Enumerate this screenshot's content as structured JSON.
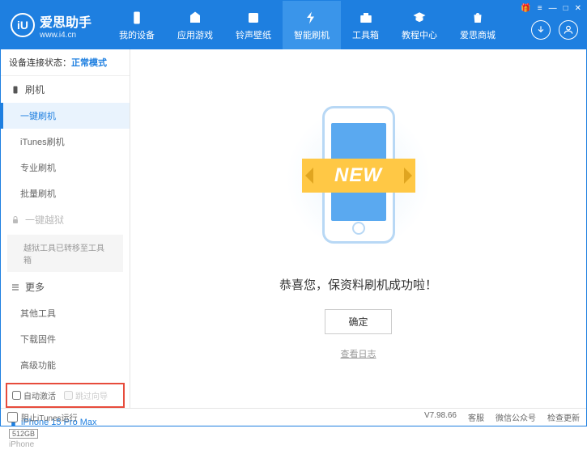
{
  "app": {
    "title": "爱思助手",
    "url": "www.i4.cn"
  },
  "winControls": {
    "gift": "🎁",
    "menu": "≡",
    "min": "—",
    "max": "□",
    "close": "✕"
  },
  "nav": [
    {
      "label": "我的设备",
      "icon": "device"
    },
    {
      "label": "应用游戏",
      "icon": "apps"
    },
    {
      "label": "铃声壁纸",
      "icon": "media"
    },
    {
      "label": "智能刷机",
      "icon": "flash",
      "active": true
    },
    {
      "label": "工具箱",
      "icon": "toolbox"
    },
    {
      "label": "教程中心",
      "icon": "tutorial"
    },
    {
      "label": "爱思商城",
      "icon": "store"
    }
  ],
  "status": {
    "label": "设备连接状态：",
    "mode": "正常模式"
  },
  "sidebar": {
    "flash": {
      "header": "刷机",
      "items": [
        "一键刷机",
        "iTunes刷机",
        "专业刷机",
        "批量刷机"
      ]
    },
    "jailbreak": {
      "header": "一键越狱",
      "note": "越狱工具已转移至工具箱"
    },
    "more": {
      "header": "更多",
      "items": [
        "其他工具",
        "下载固件",
        "高级功能"
      ]
    }
  },
  "checkboxes": {
    "auto": "自动激活",
    "skip": "跳过向导"
  },
  "device": {
    "name": "iPhone 15 Pro Max",
    "storage": "512GB",
    "type": "iPhone"
  },
  "main": {
    "ribbon": "NEW",
    "success": "恭喜您，保资料刷机成功啦！",
    "confirm": "确定",
    "log": "查看日志"
  },
  "footer": {
    "block": "阻止iTunes运行",
    "version": "V7.98.66",
    "links": [
      "客服",
      "微信公众号",
      "检查更新"
    ]
  }
}
